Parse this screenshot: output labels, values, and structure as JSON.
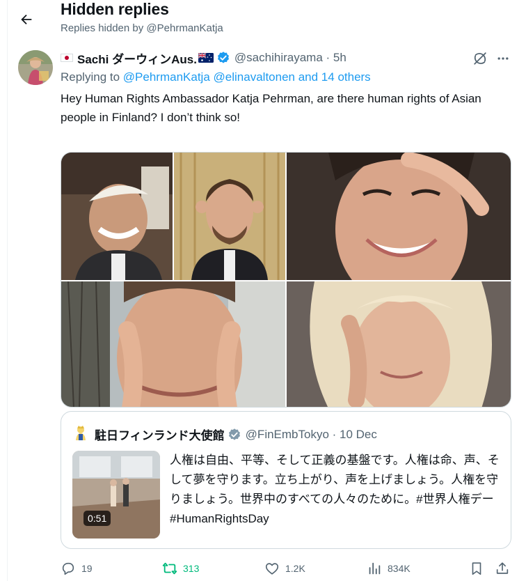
{
  "header": {
    "title": "Hidden replies",
    "subtitle": "Replies hidden by @PehrmanKatja"
  },
  "tweet": {
    "author_name": "Sachi ダーウィンAus.",
    "handle_time": "@sachihirayama · 5h",
    "replying_label": "Replying to",
    "mention_1": "@PehrmanKatja",
    "mention_2": "@elinavaltonen",
    "others": "and 14 others",
    "text": "Hey Human Rights Ambassador Katja Pehrman, are there human rights of Asian people in Finland? I don’t think so!"
  },
  "quote": {
    "author_name": "駐日フィンランド大使館",
    "handle_time": "@FinEmbTokyo · 10 Dec",
    "text": "人権は自由、平等、そして正義の基盤です。人権は命、声、そして夢を守ります。立ち上がり、声を上げましょう。人権を守りましょう。世界中のすべての人々のために。#世界人権デー #HumanRightsDay",
    "video_duration": "0:51"
  },
  "actions": {
    "replies": "19",
    "retweets": "313",
    "likes": "1.2K",
    "views": "834K"
  },
  "icons": [
    "back-arrow-icon",
    "verified-icon",
    "hidden-reply-icon",
    "more-icon",
    "reply-icon",
    "retweet-icon",
    "like-icon",
    "views-icon",
    "bookmark-icon",
    "share-icon"
  ],
  "colors": {
    "accent": "#1d9bf0",
    "retweet": "#00ba7c",
    "secondary_text": "#536471"
  }
}
